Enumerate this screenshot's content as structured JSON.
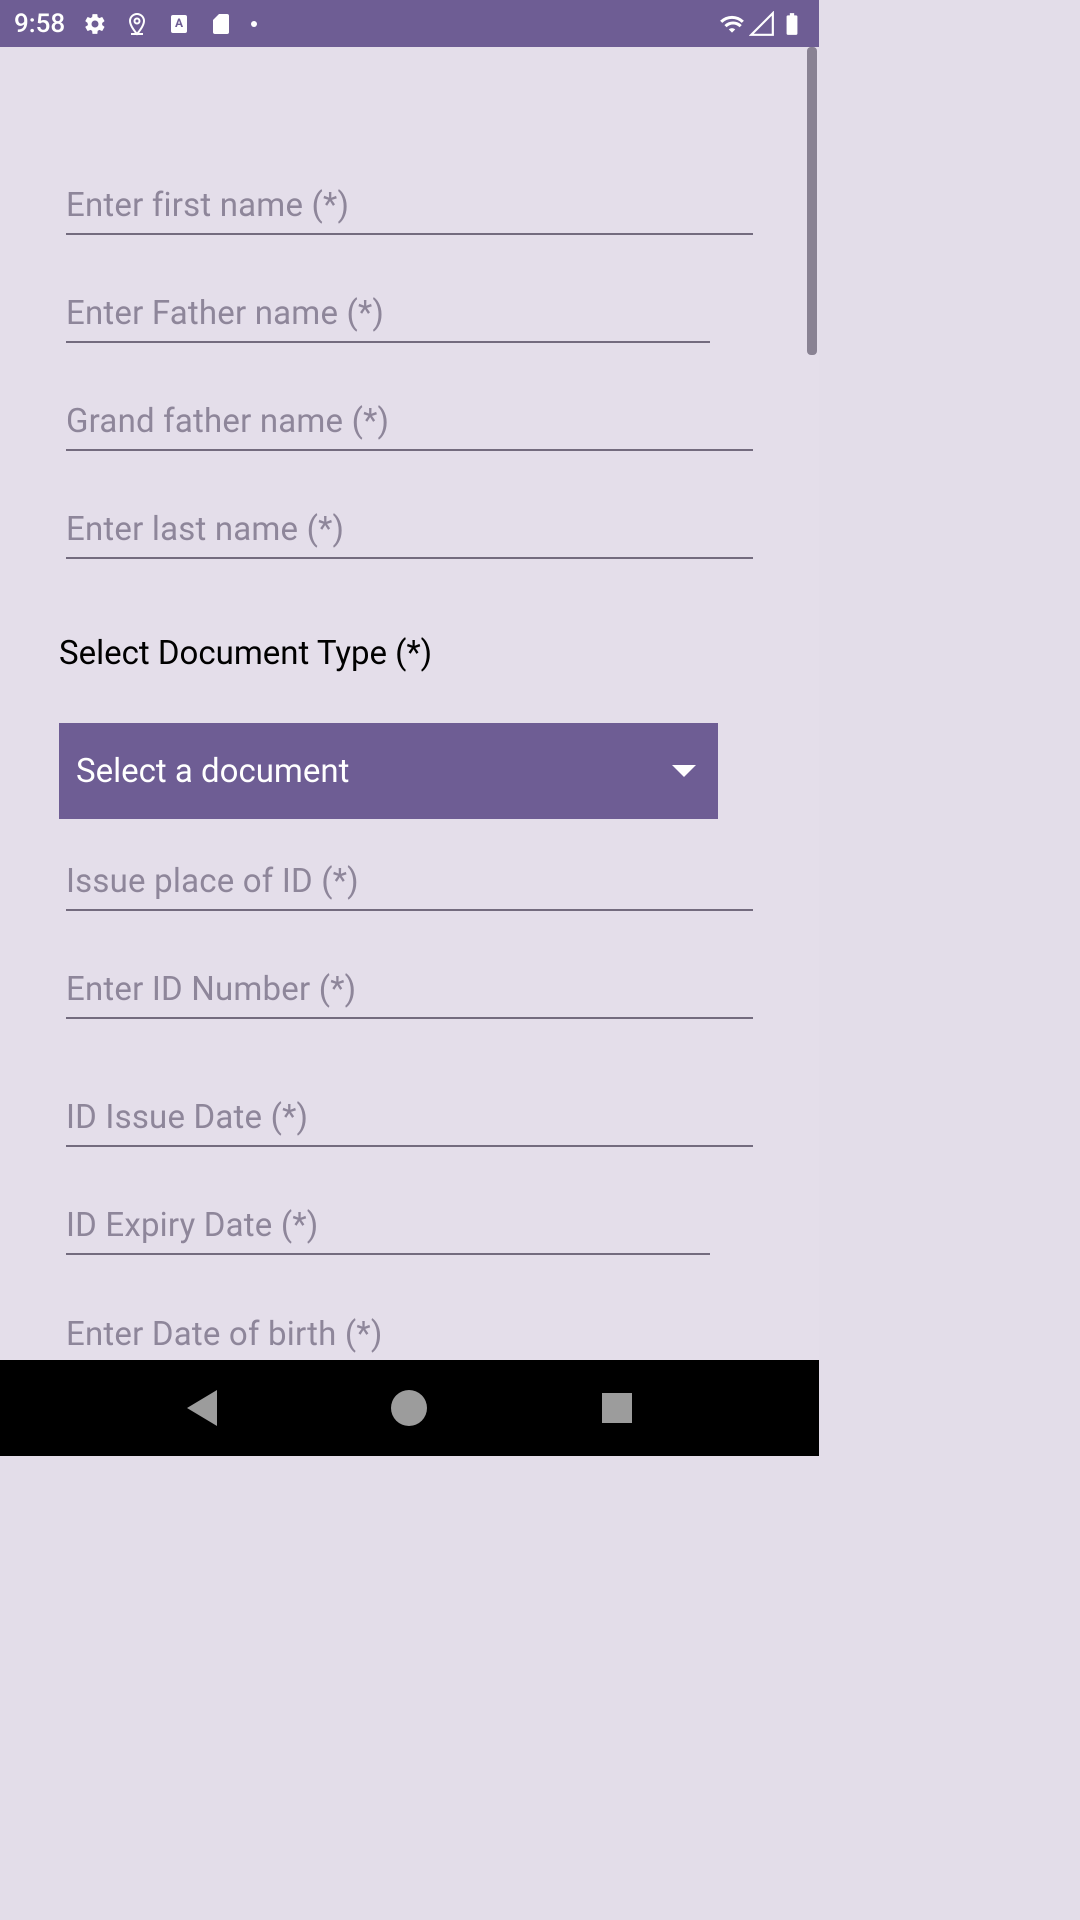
{
  "statusBar": {
    "time": "9:58"
  },
  "form": {
    "firstName": {
      "placeholder": "Enter first name (*)"
    },
    "fatherName": {
      "placeholder": "Enter Father name (*)"
    },
    "grandfatherName": {
      "placeholder": "Grand father name (*)"
    },
    "lastName": {
      "placeholder": "Enter last name (*)"
    },
    "documentTypeLabel": "Select Document Type (*)",
    "documentSelect": {
      "selected": "Select a document"
    },
    "issuePlace": {
      "placeholder": "Issue place of ID (*)"
    },
    "idNumber": {
      "placeholder": "Enter ID Number (*)"
    },
    "idIssueDate": {
      "placeholder": "ID Issue Date (*)"
    },
    "idExpiryDate": {
      "placeholder": "ID Expiry Date (*)"
    },
    "dateOfBirth": {
      "placeholder": "Enter Date of birth (*)"
    }
  }
}
